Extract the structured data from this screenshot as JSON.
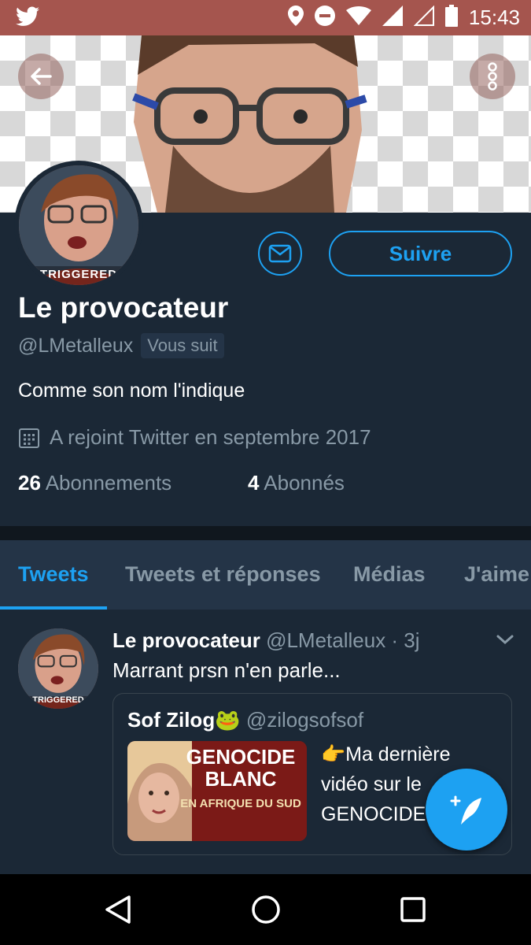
{
  "status_bar": {
    "time": "15:43",
    "icons": [
      "twitter-bird-icon",
      "location-icon",
      "do-not-disturb-icon",
      "wifi-icon",
      "signal-icon",
      "signal-empty-icon",
      "battery-icon"
    ]
  },
  "header": {
    "back_icon": "arrow-left-icon",
    "more_icon": "more-vertical-icon"
  },
  "profile": {
    "avatar_caption": "TRIGGERED",
    "message_icon": "envelope-icon",
    "follow_label": "Suivre",
    "name": "Le provocateur",
    "handle": "@LMetalleux",
    "follows_you_badge": "Vous suit",
    "bio": "Comme son nom l'indique",
    "joined_icon": "calendar-icon",
    "joined": "A rejoint Twitter en septembre 2017",
    "following_count": "26",
    "following_label": "Abonnements",
    "followers_count": "4",
    "followers_label": "Abonnés"
  },
  "tabs": [
    {
      "label": "Tweets",
      "active": true
    },
    {
      "label": "Tweets et réponses",
      "active": false
    },
    {
      "label": "Médias",
      "active": false
    },
    {
      "label": "J'aime",
      "active": false
    }
  ],
  "tweet": {
    "avatar_caption": "TRIGGERED",
    "author_name": "Le provocateur",
    "author_meta": "@LMetalleux · 3j",
    "text": "Marrant prsn n'en parle...",
    "quote": {
      "author_name": "Sof Zilog🐸",
      "author_handle": "@zilogsofsof",
      "image_title": "GENOCIDE BLANC",
      "image_subtitle": "EN AFRIQUE DU SUD",
      "text": "👉Ma dernière vidéo sur le GENOCIDE"
    }
  },
  "fab_icon": "compose-tweet-icon",
  "nav_bar": {
    "icons": [
      "back-triangle-icon",
      "home-circle-icon",
      "recents-square-icon"
    ]
  },
  "colors": {
    "accent": "#1da1f2",
    "background": "#15202b",
    "card": "#1b2836",
    "muted_text": "#8899a6",
    "status_bar": "#a5554e"
  }
}
